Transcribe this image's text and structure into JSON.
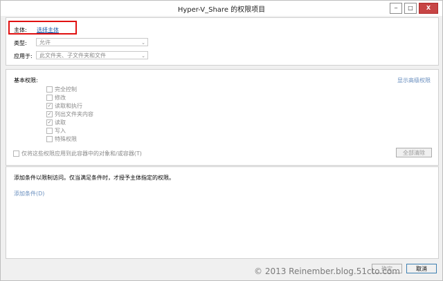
{
  "window": {
    "title": "Hyper-V_Share 的权限项目",
    "minimize": "‒",
    "maximize": "□",
    "close": "X"
  },
  "principal": {
    "label": "主体:",
    "link": "选择主体"
  },
  "type": {
    "label": "类型:",
    "value": "允许"
  },
  "applies_to": {
    "label": "应用于:",
    "value": "此文件夹、子文件夹和文件"
  },
  "basic_permissions": {
    "label": "基本权限:",
    "show_advanced": "显示高级权限",
    "items": [
      {
        "label": "完全控制",
        "checked": false
      },
      {
        "label": "修改",
        "checked": false
      },
      {
        "label": "读取和执行",
        "checked": true
      },
      {
        "label": "列出文件夹内容",
        "checked": true
      },
      {
        "label": "读取",
        "checked": true
      },
      {
        "label": "写入",
        "checked": false
      },
      {
        "label": "特殊权限",
        "checked": false
      }
    ],
    "apply_only": "仅将这些权限应用到此容器中的对象和/或容器(T)",
    "clear_all": "全部清除"
  },
  "conditions": {
    "desc": "添加条件以限制访问。仅当满足条件时，才授予主体指定的权限。",
    "add_link": "添加条件(D)"
  },
  "buttons": {
    "ok": "确定",
    "cancel": "取消"
  },
  "watermark": "© 2013 Reinember.blog.51cto.com"
}
